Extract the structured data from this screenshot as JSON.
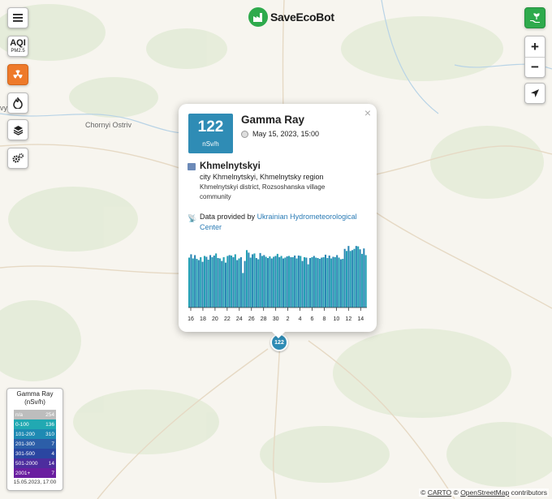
{
  "map": {
    "labels": {
      "chornyi_ostriv": "Chornyi Ostriv",
      "partial_left": "vy"
    },
    "marker_value": "122"
  },
  "brand": {
    "name": "SaveEcoBot"
  },
  "controls": {
    "menu_icon": "hamburger-icon",
    "aqi_label": "AQI",
    "aqi_sub": "PM2.5",
    "zoom_in": "+",
    "zoom_out": "−",
    "colors": {
      "active": "#ee7a2a",
      "share_btn": "#2eaa4c"
    }
  },
  "popup": {
    "value": "122",
    "unit": "nSv/h",
    "title": "Gamma Ray",
    "date": "May 15, 2023, 15:00",
    "city": "Khmelnytskyi",
    "line1": "city Khmelnytskyi, Khmelnytsky region",
    "line2": "Khmelnytskyi district, Rozsoshanska village community",
    "provider_prefix": "Data provided by",
    "provider_link": "Ukrainian Hydrometeorological Center",
    "close": "×",
    "value_color": "#2f8cb5"
  },
  "chart_data": {
    "type": "bar",
    "x_tick_labels": [
      "16",
      "18",
      "20",
      "22",
      "24",
      "26",
      "28",
      "30",
      "2",
      "4",
      "6",
      "8",
      "10",
      "12",
      "14"
    ],
    "ylim": [
      0,
      160
    ],
    "values": [
      120,
      128,
      118,
      126,
      117,
      114,
      121,
      110,
      124,
      122,
      115,
      126,
      121,
      125,
      130,
      119,
      118,
      112,
      121,
      108,
      124,
      126,
      125,
      121,
      128,
      114,
      118,
      121,
      83,
      112,
      138,
      132,
      120,
      128,
      130,
      119,
      116,
      131,
      124,
      126,
      122,
      119,
      123,
      118,
      122,
      124,
      129,
      121,
      124,
      118,
      120,
      123,
      124,
      121,
      121,
      125,
      118,
      125,
      124,
      112,
      121,
      120,
      104,
      119,
      121,
      124,
      120,
      119,
      117,
      120,
      121,
      127,
      119,
      125,
      118,
      122,
      121,
      126,
      120,
      116,
      117,
      141,
      136,
      148,
      136,
      138,
      141,
      148,
      147,
      140,
      129,
      142,
      126
    ],
    "series_colors": [
      "#23a0b4",
      "#2a86b3"
    ]
  },
  "legend": {
    "title": "Gamma Ray",
    "unit": "(nSv/h)",
    "rows": [
      {
        "range": "n/a",
        "count": "254",
        "color": "#bdbdbd"
      },
      {
        "range": "0-100",
        "count": "136",
        "color": "#21a9b2"
      },
      {
        "range": "101-200",
        "count": "310",
        "color": "#1e8ab3"
      },
      {
        "range": "201-300",
        "count": "7",
        "color": "#2c5ea8"
      },
      {
        "range": "301-500",
        "count": "4",
        "color": "#2a46a1"
      },
      {
        "range": "501-2000",
        "count": "14",
        "color": "#4d2d9e"
      },
      {
        "range": "2001+",
        "count": "7",
        "color": "#6a1ea0"
      }
    ],
    "timestamp": "15.05.2023, 17:00"
  },
  "attribution": {
    "c1": "©",
    "carto": "CARTO",
    "c2": "©",
    "osm": "OpenStreetMap",
    "contrib": "contributors"
  }
}
